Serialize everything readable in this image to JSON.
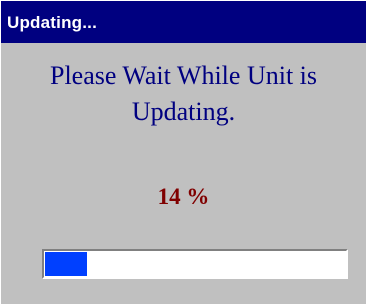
{
  "window": {
    "title": "Updating..."
  },
  "message": {
    "text": "Please Wait While Unit is\nUpdating."
  },
  "progress": {
    "label": "14 %",
    "fraction": 0.14
  },
  "colors": {
    "titlebar": "#000080",
    "message": "#000080",
    "percent": "#800000",
    "dialog_bg": "#c0c0c0",
    "progress_fill": "#0040ff"
  }
}
